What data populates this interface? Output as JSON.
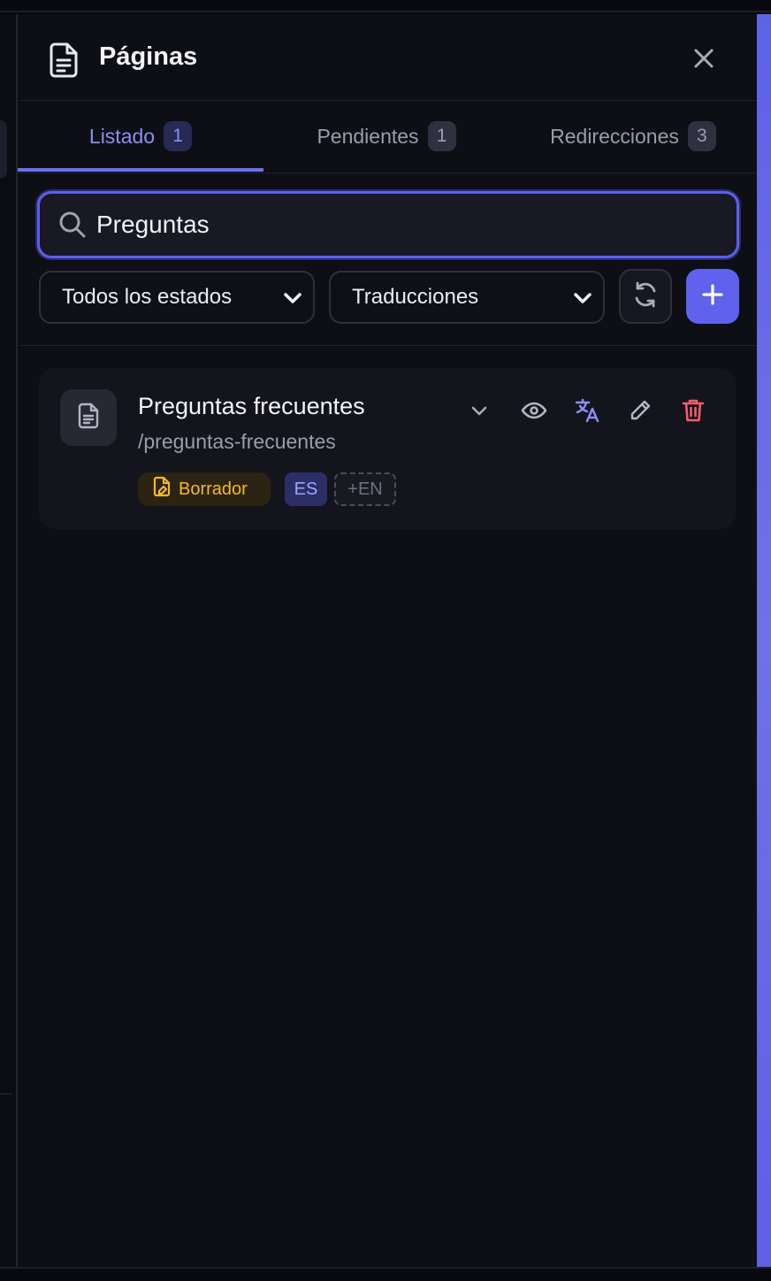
{
  "header": {
    "title": "Páginas"
  },
  "tabs": [
    {
      "label": "Listado",
      "count": "1",
      "active": true
    },
    {
      "label": "Pendientes",
      "count": "1",
      "active": false
    },
    {
      "label": "Redirecciones",
      "count": "3",
      "active": false
    }
  ],
  "search": {
    "value": "Preguntas"
  },
  "filters": {
    "status_selected": "Todos los estados",
    "translation_selected": "Traducciones"
  },
  "pages": [
    {
      "title": "Preguntas frecuentes",
      "slug": "/preguntas-frecuentes",
      "status": "Borrador",
      "lang_current": "ES",
      "lang_add": "+EN"
    }
  ],
  "colors": {
    "accent": "#5f62ec",
    "draft": "#f5b82a",
    "delete": "#f25c6b",
    "translate": "#8a8ff5"
  },
  "icons": [
    "document-icon",
    "close-icon",
    "search-icon",
    "chevron-down-icon",
    "refresh-icon",
    "plus-icon",
    "eye-icon",
    "translate-icon",
    "pencil-icon",
    "trash-icon",
    "file-edit-icon"
  ]
}
